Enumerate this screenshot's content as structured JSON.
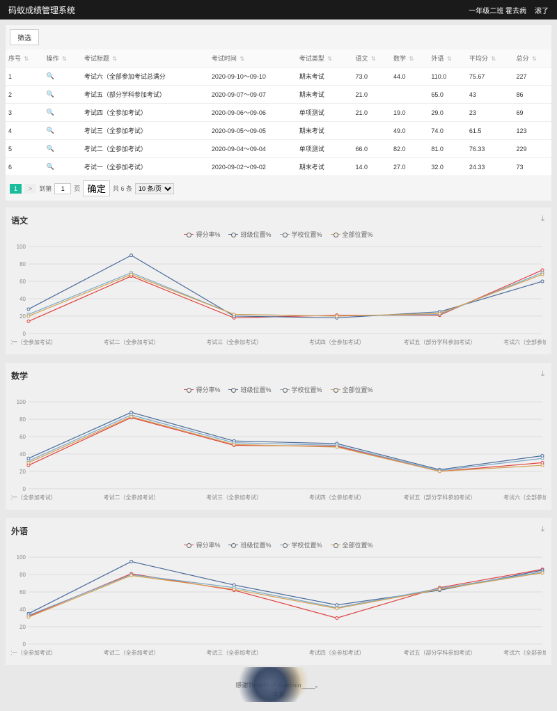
{
  "header": {
    "title": "码蚁成绩管理系统",
    "class_info": "一年级二班 霍去病",
    "logout": "滚了"
  },
  "filter_button": "筛选",
  "table": {
    "headers": [
      "序号",
      "操作",
      "考试标题",
      "考试时间",
      "考试类型",
      "语文",
      "数学",
      "外语",
      "平均分",
      "总分"
    ],
    "rows": [
      {
        "idx": "1",
        "title": "考试六（全部参加考试总满分",
        "time": "2020-09-10～09-10",
        "type": "期末考试",
        "yw": "73.0",
        "sx": "44.0",
        "wy": "110.0",
        "avg": "75.67",
        "total": "227"
      },
      {
        "idx": "2",
        "title": "考试五（部分学科参加考试）",
        "time": "2020-09-07～09-07",
        "type": "期末考试",
        "yw": "21.0",
        "sx": "",
        "wy": "65.0",
        "avg": "43",
        "total": "86"
      },
      {
        "idx": "3",
        "title": "考试四（全参加考试）",
        "time": "2020-09-06～09-06",
        "type": "单项测试",
        "yw": "21.0",
        "sx": "19.0",
        "wy": "29.0",
        "avg": "23",
        "total": "69"
      },
      {
        "idx": "4",
        "title": "考试三（全参加考试）",
        "time": "2020-09-05～09-05",
        "type": "期末考试",
        "yw": "",
        "sx": "49.0",
        "wy": "74.0",
        "avg": "61.5",
        "total": "123"
      },
      {
        "idx": "5",
        "title": "考试二（全参加考试）",
        "time": "2020-09-04～09-04",
        "type": "单项测试",
        "yw": "66.0",
        "sx": "82.0",
        "wy": "81.0",
        "avg": "76.33",
        "total": "229"
      },
      {
        "idx": "6",
        "title": "考试一（全参加考试）",
        "time": "2020-09-02～09-02",
        "type": "期末考试",
        "yw": "14.0",
        "sx": "27.0",
        "wy": "32.0",
        "avg": "24.33",
        "total": "73"
      }
    ]
  },
  "pagination": {
    "current": "1",
    "next": ">",
    "jump_label": "到第",
    "page_label": "页",
    "go_label": "确定",
    "total_label": "共 6 条",
    "per_page": "10 条/页"
  },
  "legend": [
    "得分率%",
    "班级位置%",
    "学校位置%",
    "全部位置%"
  ],
  "legend_colors": [
    "#e04040",
    "#4a6a9a",
    "#7aa8c8",
    "#d4a050"
  ],
  "charts": [
    {
      "title": "语文"
    },
    {
      "title": "数学"
    },
    {
      "title": "外语"
    }
  ],
  "chart_data": [
    {
      "type": "line",
      "title": "语文",
      "ylim": [
        0,
        100
      ],
      "categories": [
        "考试一（全参加考试）",
        "考试二（全参加考试）",
        "考试三（全参加考试）",
        "考试四（全参加考试）",
        "考试五（部分学科参加考试）",
        "考试六（全部参加考试总满分不"
      ],
      "series": [
        {
          "name": "得分率%",
          "values": [
            14,
            66,
            18,
            21,
            21,
            73
          ],
          "color": "#e04040"
        },
        {
          "name": "班级位置%",
          "values": [
            28,
            90,
            20,
            18,
            25,
            60
          ],
          "color": "#4a6a9a"
        },
        {
          "name": "学校位置%",
          "values": [
            22,
            70,
            22,
            20,
            22,
            70
          ],
          "color": "#7aa8c8"
        },
        {
          "name": "全部位置%",
          "values": [
            20,
            68,
            22,
            20,
            23,
            68
          ],
          "color": "#d4a050"
        }
      ]
    },
    {
      "type": "line",
      "title": "数学",
      "ylim": [
        0,
        100
      ],
      "categories": [
        "考试一（全参加考试）",
        "考试二（全参加考试）",
        "考试三（全参加考试）",
        "考试四（全参加考试）",
        "考试五（部分学科参加考试）",
        "考试六（全部参加考试总满分不"
      ],
      "series": [
        {
          "name": "得分率%",
          "values": [
            27,
            82,
            50,
            49,
            20,
            30
          ],
          "color": "#e04040"
        },
        {
          "name": "班级位置%",
          "values": [
            35,
            88,
            55,
            52,
            22,
            38
          ],
          "color": "#4a6a9a"
        },
        {
          "name": "学校位置%",
          "values": [
            32,
            85,
            53,
            50,
            21,
            35
          ],
          "color": "#7aa8c8"
        },
        {
          "name": "全部位置%",
          "values": [
            30,
            83,
            51,
            48,
            20,
            27
          ],
          "color": "#d4a050"
        }
      ]
    },
    {
      "type": "line",
      "title": "外语",
      "ylim": [
        0,
        100
      ],
      "categories": [
        "考试一（全参加考试）",
        "考试二（全参加考试）",
        "考试三（全参加考试）",
        "考试四（全参加考试）",
        "考试五（部分学科参加考试）",
        "考试六（全部参加考试总满分不"
      ],
      "series": [
        {
          "name": "得分率%",
          "values": [
            32,
            81,
            62,
            30,
            65,
            86
          ],
          "color": "#e04040"
        },
        {
          "name": "班级位置%",
          "values": [
            35,
            95,
            68,
            45,
            62,
            85
          ],
          "color": "#4a6a9a"
        },
        {
          "name": "学校位置%",
          "values": [
            33,
            80,
            65,
            42,
            64,
            83
          ],
          "color": "#7aa8c8"
        },
        {
          "name": "全部位置%",
          "values": [
            31,
            79,
            63,
            41,
            63,
            82
          ],
          "color": "#d4a050"
        }
      ]
    }
  ],
  "footer": {
    "line1": "感谢ThinkPHP X-admin____。",
    "line2": "本系"
  }
}
